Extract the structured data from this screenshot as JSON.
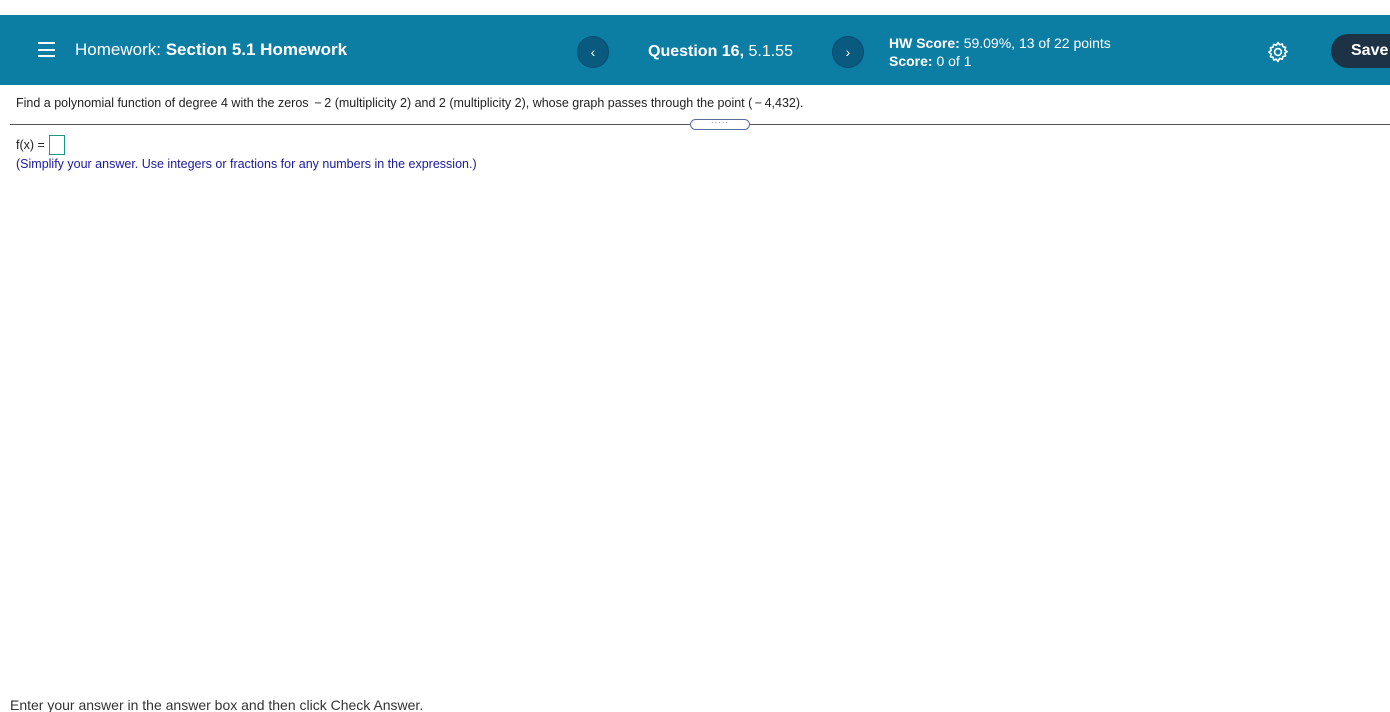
{
  "header": {
    "homework_prefix": "Homework:",
    "homework_name": "Section 5.1 Homework",
    "prev_label": "‹",
    "next_label": "›",
    "question_prefix": "Question 16,",
    "question_id": "5.1.55",
    "hw_score_label": "HW Score:",
    "hw_score_value": "59.09%, 13 of 22 points",
    "score_label": "Score:",
    "score_value": "0 of 1",
    "save_label": "Save",
    "icons": [
      "menu-icon",
      "chevron-left-icon",
      "chevron-right-icon",
      "gear-icon"
    ],
    "bar_color": "#0c7da3"
  },
  "question": {
    "text": "Find a polynomial function of degree 4 with the zeros  − 2 (multiplicity 2) and 2 (multiplicity 2), whose graph passes through the point ( − 4,432).",
    "splitter_label": "·····",
    "answer_label": "f(x) =",
    "answer_value": "",
    "hint": "(Simplify your answer. Use integers or fractions for any numbers in the expression.)"
  },
  "footer": {
    "instruction": "Enter your answer in the answer box and then click Check Answer."
  }
}
